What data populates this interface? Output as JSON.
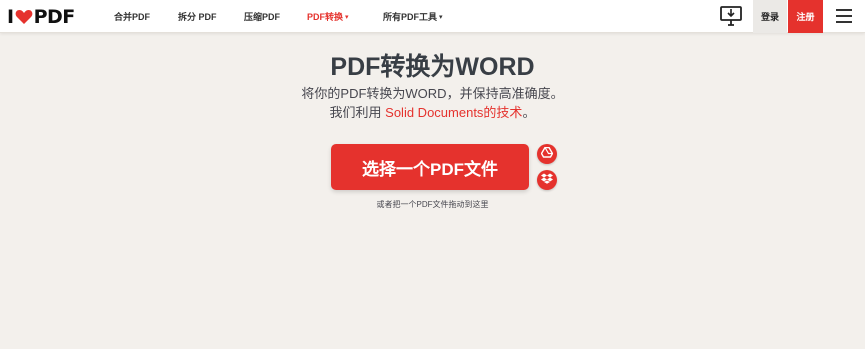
{
  "header": {
    "logo": {
      "left": "I",
      "right": "PDF"
    },
    "nav": [
      {
        "label": "合并PDF"
      },
      {
        "label": "拆分 PDF"
      },
      {
        "label": "压缩PDF"
      },
      {
        "label": "PDF转换",
        "caret": "▾"
      },
      {
        "label": "所有PDF工具",
        "caret": "▾"
      }
    ],
    "login_label": "登录",
    "signup_label": "注册"
  },
  "main": {
    "title": "PDF转换为WORD",
    "subtitle_line1": "将你的PDF转换为WORD，并保持高准确度。",
    "subtitle_line2_prefix": "我们利用 ",
    "subtitle_line2_link": "Solid Documents的技术",
    "subtitle_line2_suffix": "。",
    "select_button": "选择一个PDF文件",
    "drop_hint": "或者把一个PDF文件拖动到这里"
  },
  "colors": {
    "accent": "#e5322d",
    "background": "#f3f0ec"
  }
}
